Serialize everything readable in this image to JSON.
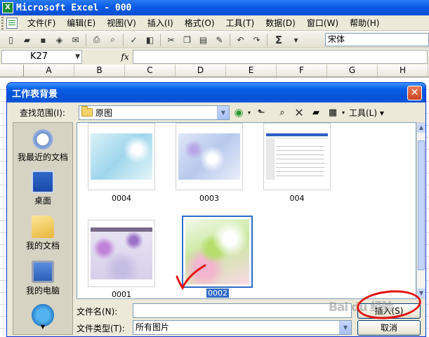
{
  "window": {
    "title": "Microsoft Excel - 000",
    "app_icon": "excel-icon"
  },
  "menu": [
    "文件(F)",
    "编辑(E)",
    "视图(V)",
    "插入(I)",
    "格式(O)",
    "工具(T)",
    "数据(D)",
    "窗口(W)",
    "帮助(H)"
  ],
  "toolbar": {
    "sigma": "Σ",
    "font": "宋体"
  },
  "formula": {
    "name_box": "K27",
    "fx": "fx"
  },
  "columns": [
    "A",
    "B",
    "C",
    "D",
    "E",
    "F",
    "G",
    "H"
  ],
  "dialog": {
    "title": "工作表背景",
    "close": "✕",
    "look_in_label": "查找范围(I):",
    "look_in_value": "原图",
    "tools_label": "工具(L)",
    "places": [
      {
        "label": "我最近的文档",
        "icon": "recent-docs-icon"
      },
      {
        "label": "桌面",
        "icon": "desktop-icon"
      },
      {
        "label": "我的文档",
        "icon": "my-documents-icon"
      },
      {
        "label": "我的电脑",
        "icon": "my-computer-icon"
      },
      {
        "label": "",
        "icon": "network-icon"
      }
    ],
    "files": [
      {
        "name": "0004"
      },
      {
        "name": "0003"
      },
      {
        "name": "004"
      },
      {
        "name": "0001"
      },
      {
        "name": "0002",
        "selected": true
      }
    ],
    "file_name_label": "文件名(N):",
    "file_name_value": "",
    "file_type_label": "文件类型(T):",
    "file_type_value": "所有图片",
    "insert_button": "插入(S)",
    "cancel_button": "取消"
  },
  "colors": {
    "title_blue": "#0a5ae6",
    "selection": "#316ac5",
    "annotation_red": "#e41010"
  },
  "watermark": "Bai du 经验"
}
